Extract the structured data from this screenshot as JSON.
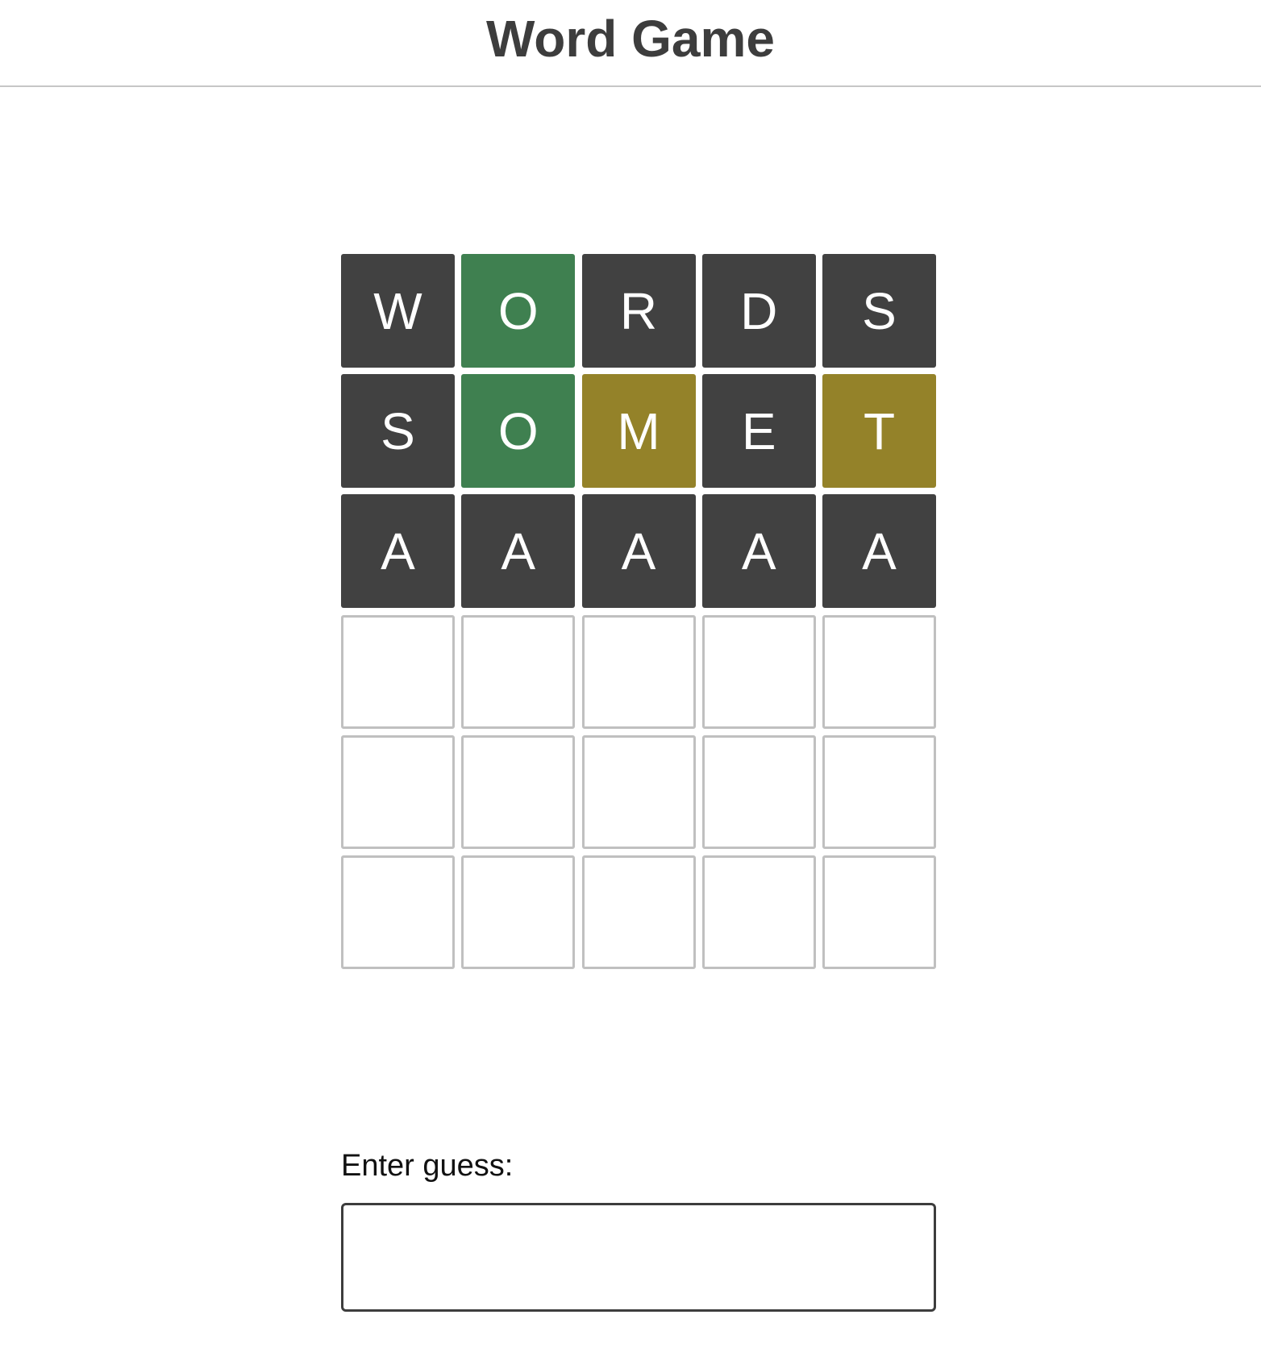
{
  "header": {
    "title": "Word Game"
  },
  "colors": {
    "correct": "#3f8050",
    "present": "#948229",
    "absent": "#414141",
    "empty_border": "#c0c0c0",
    "text": "#ffffff"
  },
  "board": {
    "rows": [
      [
        {
          "letter": "W",
          "state": "absent"
        },
        {
          "letter": "O",
          "state": "correct"
        },
        {
          "letter": "R",
          "state": "absent"
        },
        {
          "letter": "D",
          "state": "absent"
        },
        {
          "letter": "S",
          "state": "absent"
        }
      ],
      [
        {
          "letter": "S",
          "state": "absent"
        },
        {
          "letter": "O",
          "state": "correct"
        },
        {
          "letter": "M",
          "state": "present"
        },
        {
          "letter": "E",
          "state": "absent"
        },
        {
          "letter": "T",
          "state": "present"
        }
      ],
      [
        {
          "letter": "A",
          "state": "absent"
        },
        {
          "letter": "A",
          "state": "absent"
        },
        {
          "letter": "A",
          "state": "absent"
        },
        {
          "letter": "A",
          "state": "absent"
        },
        {
          "letter": "A",
          "state": "absent"
        }
      ],
      [
        {
          "letter": "",
          "state": "empty"
        },
        {
          "letter": "",
          "state": "empty"
        },
        {
          "letter": "",
          "state": "empty"
        },
        {
          "letter": "",
          "state": "empty"
        },
        {
          "letter": "",
          "state": "empty"
        }
      ],
      [
        {
          "letter": "",
          "state": "empty"
        },
        {
          "letter": "",
          "state": "empty"
        },
        {
          "letter": "",
          "state": "empty"
        },
        {
          "letter": "",
          "state": "empty"
        },
        {
          "letter": "",
          "state": "empty"
        }
      ],
      [
        {
          "letter": "",
          "state": "empty"
        },
        {
          "letter": "",
          "state": "empty"
        },
        {
          "letter": "",
          "state": "empty"
        },
        {
          "letter": "",
          "state": "empty"
        },
        {
          "letter": "",
          "state": "empty"
        }
      ]
    ]
  },
  "guess": {
    "label": "Enter guess:",
    "value": "",
    "placeholder": ""
  }
}
